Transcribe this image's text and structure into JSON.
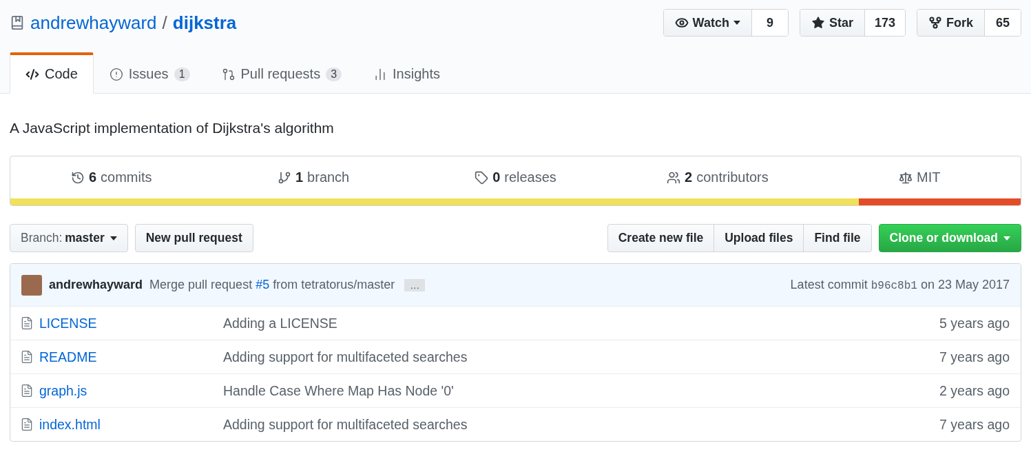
{
  "repo": {
    "owner": "andrewhayward",
    "separator": "/",
    "name": "dijkstra"
  },
  "actions": [
    {
      "kind": "watch",
      "label": "Watch",
      "count": "9",
      "dropdown": true
    },
    {
      "kind": "star",
      "label": "Star",
      "count": "173",
      "dropdown": false
    },
    {
      "kind": "fork",
      "label": "Fork",
      "count": "65",
      "dropdown": false
    }
  ],
  "tabs": [
    {
      "kind": "code",
      "label": "Code",
      "selected": true
    },
    {
      "kind": "issues",
      "label": "Issues",
      "count": "1",
      "selected": false
    },
    {
      "kind": "pulls",
      "label": "Pull requests",
      "count": "3",
      "selected": false
    },
    {
      "kind": "insights",
      "label": "Insights",
      "selected": false
    }
  ],
  "description": "A JavaScript implementation of Dijkstra's algorithm",
  "summary": [
    {
      "kind": "commits",
      "number": "6",
      "label": "commits"
    },
    {
      "kind": "branch",
      "number": "1",
      "label": "branch"
    },
    {
      "kind": "releases",
      "number": "0",
      "label": "releases"
    },
    {
      "kind": "contributors",
      "number": "2",
      "label": "contributors"
    },
    {
      "kind": "license",
      "label": "MIT"
    }
  ],
  "languages": [
    {
      "color": "#f1e05a",
      "level": 0.84
    },
    {
      "color": "#e34c26",
      "level": 0.16
    }
  ],
  "branch_button": {
    "label": "Branch:",
    "value": "master"
  },
  "new_pull_request": "New pull request",
  "file_buttons": [
    "Create new file",
    "Upload files",
    "Find file"
  ],
  "clone_button": "Clone or download",
  "commit": {
    "author": "andrewhayward",
    "message_before": "Merge pull request",
    "link": "#5",
    "message_after": "from tetratorus/master",
    "ellipsis": "…",
    "prefix": "Latest commit",
    "sha": "b96c8b1",
    "date": "on 23 May 2017"
  },
  "files": [
    {
      "name": "LICENSE",
      "message": "Adding a LICENSE",
      "age": "5 years ago"
    },
    {
      "name": "README",
      "message": "Adding support for multifaceted searches",
      "age": "7 years ago"
    },
    {
      "name": "graph.js",
      "message": "Handle Case Where Map Has Node '0'",
      "age": "2 years ago"
    },
    {
      "name": "index.html",
      "message": "Adding support for multifaceted searches",
      "age": "7 years ago"
    }
  ]
}
